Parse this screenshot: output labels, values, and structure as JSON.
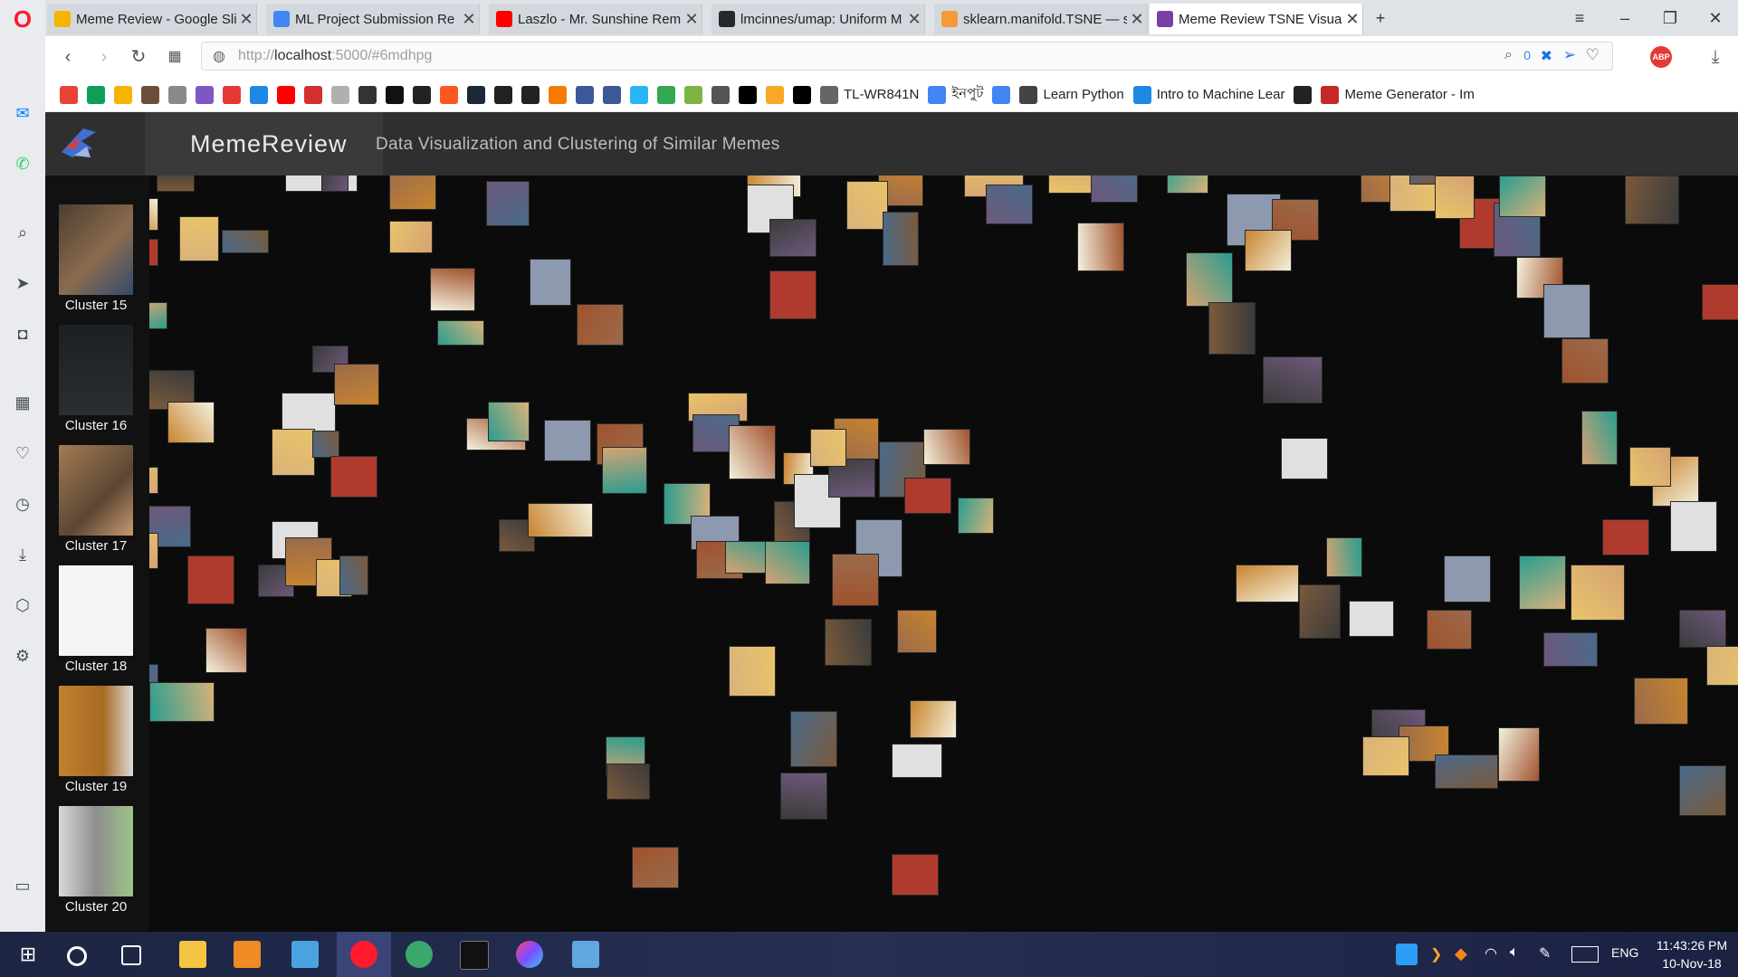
{
  "tabs": [
    {
      "title": "Meme Review - Google Sli",
      "color": "#f4b400"
    },
    {
      "title": "ML Project Submission Re",
      "color": "#4285f4"
    },
    {
      "title": "Laszlo - Mr. Sunshine Rem",
      "color": "#ff0000"
    },
    {
      "title": "lmcinnes/umap: Uniform M",
      "color": "#24292e"
    },
    {
      "title": "sklearn.manifold.TSNE — s",
      "color": "#f89939"
    },
    {
      "title": "Meme Review TSNE Visual",
      "color": "#7b3fa0"
    }
  ],
  "address": {
    "prefix": "http://",
    "host": "localhost",
    "rest": ":5000/#6mdhpg"
  },
  "address_badge": "0",
  "bookmarks": [
    {
      "label": "",
      "color": "#ea4335"
    },
    {
      "label": "",
      "color": "#0f9d58"
    },
    {
      "label": "",
      "color": "#f4b400"
    },
    {
      "label": "",
      "color": "#6b4f3a"
    },
    {
      "label": "",
      "color": "#8a8a8a"
    },
    {
      "label": "",
      "color": "#7e57c2"
    },
    {
      "label": "",
      "color": "#e53935"
    },
    {
      "label": "",
      "color": "#1e88e5"
    },
    {
      "label": "",
      "color": "#ff0000"
    },
    {
      "label": "",
      "color": "#d32f2f"
    },
    {
      "label": "",
      "color": "#b0b0b0"
    },
    {
      "label": "",
      "color": "#333333"
    },
    {
      "label": "",
      "color": "#111111"
    },
    {
      "label": "",
      "color": "#222222"
    },
    {
      "label": "",
      "color": "#ff5722"
    },
    {
      "label": "",
      "color": "#1b2838"
    },
    {
      "label": "",
      "color": "#222222"
    },
    {
      "label": "",
      "color": "#222222"
    },
    {
      "label": "",
      "color": "#f57c00"
    },
    {
      "label": "",
      "color": "#3b5998"
    },
    {
      "label": "",
      "color": "#3b5998"
    },
    {
      "label": "",
      "color": "#29b6f6"
    },
    {
      "label": "",
      "color": "#34a853"
    },
    {
      "label": "",
      "color": "#7cb342"
    },
    {
      "label": "",
      "color": "#555555"
    },
    {
      "label": "",
      "color": "#000000"
    },
    {
      "label": "",
      "color": "#f9a825"
    },
    {
      "label": "",
      "color": "#000000"
    },
    {
      "label": "TL-WR841N",
      "color": "#666666"
    },
    {
      "label": "ইনপুট",
      "color": "#4285f4"
    },
    {
      "label": "",
      "color": "#4285f4"
    },
    {
      "label": "Learn Python",
      "color": "#444444"
    },
    {
      "label": "Intro to Machine Lear",
      "color": "#1e88e5"
    },
    {
      "label": "",
      "color": "#222222"
    },
    {
      "label": "Meme Generator - Im",
      "color": "#c62828"
    }
  ],
  "header": {
    "brand": "MemeReview",
    "subtitle": "Data Visualization and Clustering of Similar Memes"
  },
  "clusters": [
    {
      "label": "Cluster 15",
      "color": "#6e5a48"
    },
    {
      "label": "Cluster 16",
      "color": "#202428"
    },
    {
      "label": "Cluster 17",
      "color": "#8a6a4c"
    },
    {
      "label": "Cluster 18",
      "color": "#f2f2f2"
    },
    {
      "label": "Cluster 19",
      "color": "#b87a2c"
    },
    {
      "label": "Cluster 20",
      "color": "#b9c4a8"
    }
  ],
  "taskbar": {
    "lang": "ENG",
    "time": "11:43:26 PM",
    "date": "10-Nov-18"
  }
}
